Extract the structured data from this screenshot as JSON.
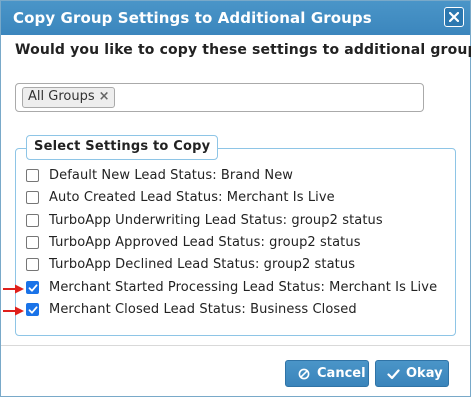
{
  "dialog": {
    "title": "Copy Group Settings to Additional Groups",
    "close_icon": "close-icon",
    "question": "Would you like to copy these settings to additional groups?",
    "groups_field": {
      "selected_tags": [
        "All Groups"
      ],
      "remove_glyph": "×"
    },
    "settings_section": {
      "legend": "Select Settings to Copy",
      "items": [
        {
          "label": "Default New Lead Status: Brand New",
          "checked": false,
          "arrow": false
        },
        {
          "label": "Auto Created Lead Status: Merchant Is Live",
          "checked": false,
          "arrow": false
        },
        {
          "label": "TurboApp Underwriting Lead Status: group2 status",
          "checked": false,
          "arrow": false
        },
        {
          "label": "TurboApp Approved Lead Status: group2 status",
          "checked": false,
          "arrow": false
        },
        {
          "label": "TurboApp Declined Lead Status: group2 status",
          "checked": false,
          "arrow": false
        },
        {
          "label": "Merchant Started Processing Lead Status: Merchant Is Live",
          "checked": true,
          "arrow": true
        },
        {
          "label": "Merchant Closed Lead Status: Business Closed",
          "checked": true,
          "arrow": true
        }
      ]
    },
    "buttons": {
      "cancel": {
        "label": "Cancel",
        "icon": "ban-icon"
      },
      "okay": {
        "label": "Okay",
        "icon": "check-icon"
      }
    },
    "colors": {
      "titlebar": "#3b86bd",
      "checkbox_checked": "#1a73e8",
      "arrow": "#e0201b",
      "fieldset_border": "#8ec5e6"
    }
  }
}
